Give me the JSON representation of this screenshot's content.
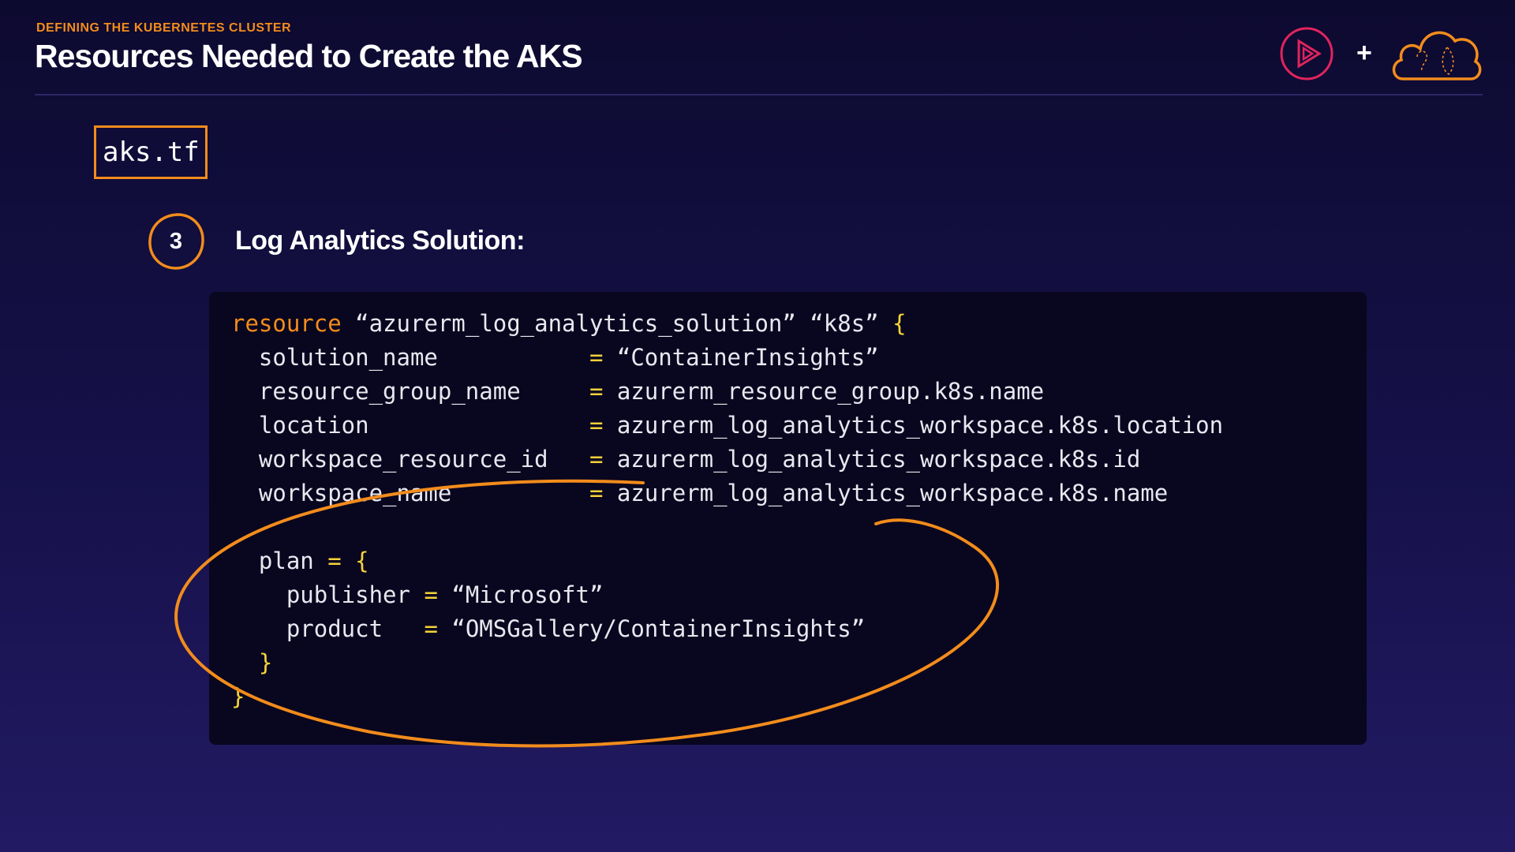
{
  "header": {
    "eyebrow": "DEFINING THE KUBERNETES CLUSTER",
    "title": "Resources Needed to Create the AKS",
    "plus": "+"
  },
  "logos": {
    "left": "play-icon",
    "right": "cloud-icon"
  },
  "file": {
    "name": "aks.tf"
  },
  "step": {
    "number": "3",
    "title": "Log Analytics Solution:"
  },
  "code": {
    "l1": {
      "kw": "resource",
      "text": " “azurerm_log_analytics_solution” “k8s” ",
      "brace": "{"
    },
    "l2": {
      "key": "  solution_name           ",
      "eq": "=",
      "val": " “ContainerInsights”"
    },
    "l3": {
      "key": "  resource_group_name     ",
      "eq": "=",
      "val": " azurerm_resource_group.k8s.name"
    },
    "l4": {
      "key": "  location                ",
      "eq": "=",
      "val": " azurerm_log_analytics_workspace.k8s.location"
    },
    "l5": {
      "key": "  workspace_resource_id   ",
      "eq": "=",
      "val": " azurerm_log_analytics_workspace.k8s.id"
    },
    "l6": {
      "key": "  workspace_name          ",
      "eq": "=",
      "val": " azurerm_log_analytics_workspace.k8s.name"
    },
    "l8": {
      "key": "  plan ",
      "eq": "=",
      "brace": " {"
    },
    "l9": {
      "key": "    publisher ",
      "eq": "=",
      "val": " “Microsoft”"
    },
    "l10": {
      "key": "    product   ",
      "eq": "=",
      "val": " “OMSGallery/ContainerInsights”"
    },
    "l11": {
      "brace": "  }"
    },
    "l12": {
      "brace": "}"
    }
  },
  "colors": {
    "accent": "#f28c1c",
    "brace": "#f5d33a",
    "logo_ring": "#e0245e"
  }
}
